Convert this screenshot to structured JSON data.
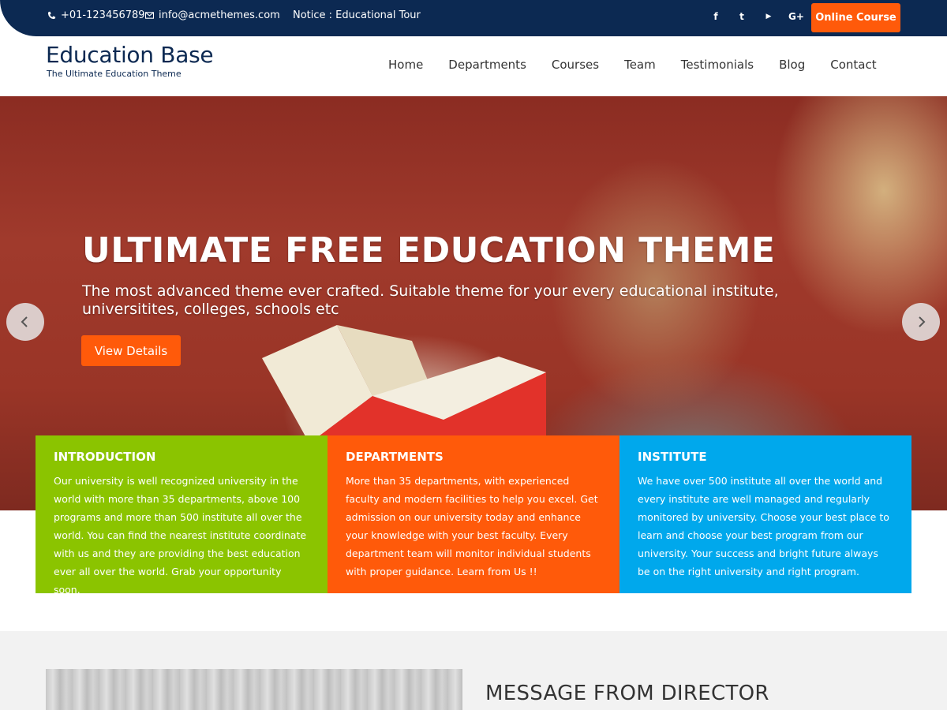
{
  "topbar": {
    "phone": "+01-123456789",
    "email": "info@acmethemes.com",
    "notice": "Notice : Educational Tour",
    "social": [
      "facebook-icon",
      "twitter-icon",
      "youtube-icon",
      "google-plus-icon"
    ],
    "social_glyphs": {
      "facebook": "f",
      "twitter": "t",
      "youtube": "▶",
      "google_plus": "G+"
    },
    "cta_label": "Online Course"
  },
  "header": {
    "site_title": "Education Base",
    "tagline": "The Ultimate Education Theme",
    "nav": [
      {
        "label": "Home"
      },
      {
        "label": "Departments"
      },
      {
        "label": "Courses"
      },
      {
        "label": "Team"
      },
      {
        "label": "Testimonials"
      },
      {
        "label": "Blog"
      },
      {
        "label": "Contact"
      }
    ]
  },
  "hero": {
    "title": "ULTIMATE FREE EDUCATION THEME",
    "subtitle": "The most advanced theme ever crafted. Suitable theme for your every educational institute, universitites, colleges, schools etc",
    "button_label": "View Details",
    "prev_icon": "chevron-left-icon",
    "next_icon": "chevron-right-icon"
  },
  "features": [
    {
      "title": "INTRODUCTION",
      "text": "Our university is well recognized university in the world with more than 35 departments, above 100 programs and more than 500 institute all over the world. You can find the nearest institute coordinate with us and they are providing the best education ever all over the world. Grab your opportunity soon.",
      "color": "#8bc400"
    },
    {
      "title": "DEPARTMENTS",
      "text": "More than 35 departments, with experienced faculty and modern facilities to help you excel. Get admission on our university today and enhance your knowledge with your best faculty. Every department team will monitor individual students with proper guidance. Learn from Us !!",
      "color": "#ff5a0a"
    },
    {
      "title": "INSTITUTE",
      "text": "We have over 500 institute all over the world and every institute are well managed and regularly monitored by university. Choose your best place to learn and choose your best program from our university. Your success and bright future always be on the right university and right program.",
      "color": "#00a8ec"
    }
  ],
  "director": {
    "title": "MESSAGE FROM DIRECTOR"
  },
  "colors": {
    "topbar": "#0c2952",
    "accent": "#ff5a0a",
    "green": "#8bc400",
    "blue": "#00a8ec"
  }
}
